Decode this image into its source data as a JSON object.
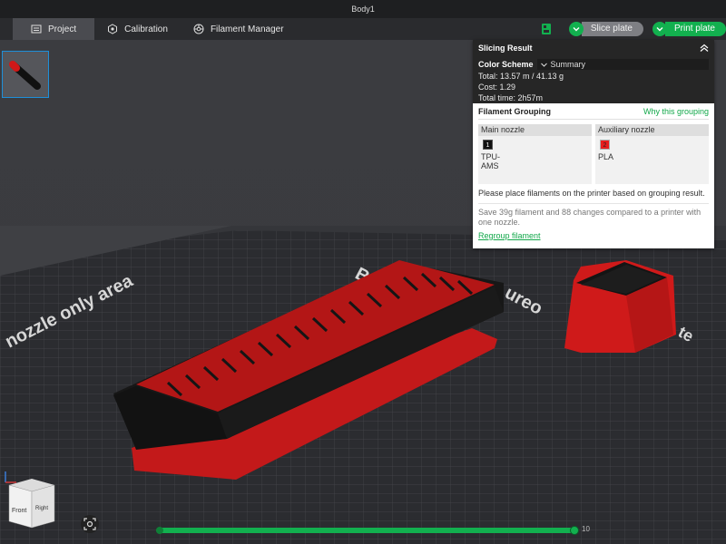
{
  "window": {
    "title": "Body1"
  },
  "topbar": {
    "tabs": [
      {
        "label": "Project",
        "icon": "project-icon"
      },
      {
        "label": "Calibration",
        "icon": "calibration-icon"
      },
      {
        "label": "Filament Manager",
        "icon": "filament-manager-icon"
      }
    ],
    "slice_label": "Slice plate",
    "print_label": "Print plate",
    "colors": {
      "accent": "#12b04f",
      "bar_bg": "#2a2b2e",
      "active_tab": "#4a4b50"
    }
  },
  "viewport": {
    "bed_labels": [
      "nozzle only area",
      "Ba",
      "ureo",
      "te"
    ],
    "model_colors": {
      "red": "#d31a1a",
      "black": "#151515"
    },
    "cube_faces": {
      "front": "Front",
      "right": "Right"
    },
    "layer_value": "10",
    "layer_progress": 1.0
  },
  "slicing_result": {
    "title": "Slicing Result",
    "color_scheme_label": "Color Scheme",
    "color_scheme_value": "Summary",
    "total": "Total:  13.57 m / 41.13 g",
    "cost": "Cost:  1.29",
    "total_time": "Total time:  2h57m"
  },
  "filament_grouping": {
    "title": "Filament Grouping",
    "why_link": "Why this grouping",
    "main_nozzle": {
      "label": "Main nozzle",
      "chip": "1",
      "chip_color": "#111111",
      "name": "TPU-AMS"
    },
    "aux_nozzle": {
      "label": "Auxiliary nozzle",
      "chip": "2",
      "chip_color": "#e81d1d",
      "name": "PLA"
    },
    "hint": "Please place filaments on the printer based on grouping result.",
    "save_text": "Save 39g filament and 88 changes compared to a printer with one nozzle.",
    "regroup_link": "Regroup filament"
  }
}
